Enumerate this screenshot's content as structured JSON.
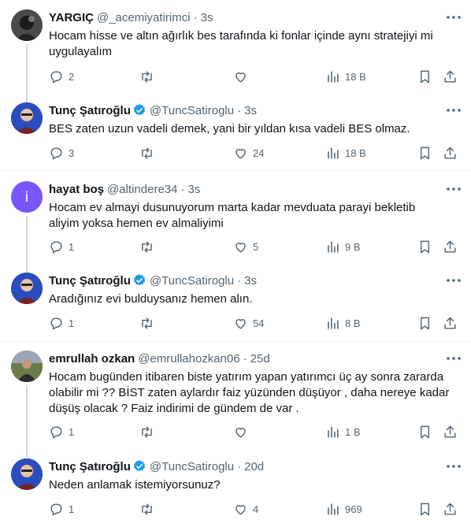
{
  "tweets": [
    {
      "name": "YARGIÇ",
      "handle": "@_acemiyatirimci",
      "time": "3s",
      "verified": false,
      "text_lines": [
        "Hocam hisse ve altın ağırlık bes tarafında ki fonlar içinde aynı stratejiyi mi",
        "uygulayalım"
      ],
      "replies": "2",
      "retweets": "",
      "likes": "",
      "views": "18 B"
    },
    {
      "name": "Tunç Şatıroğlu",
      "handle": "@TuncSatiroglu",
      "time": "3s",
      "verified": true,
      "text_lines": [
        "BES zaten uzun vadeli demek, yani bir yıldan kısa vadeli BES olmaz."
      ],
      "replies": "3",
      "retweets": "",
      "likes": "24",
      "views": "18 B"
    },
    {
      "name": "hayat boş",
      "handle": "@altindere34",
      "time": "3s",
      "verified": false,
      "avatar_letter": "i",
      "text_lines": [
        "Hocam ev almayi dusunuyorum marta kadar mevduata  parayi bekletib",
        "aliyim yoksa hemen ev almaliyimi"
      ],
      "replies": "1",
      "retweets": "",
      "likes": "5",
      "views": "9 B"
    },
    {
      "name": "Tunç Şatıroğlu",
      "handle": "@TuncSatiroglu",
      "time": "3s",
      "verified": true,
      "text_lines": [
        "Aradığınız evi bulduysanız hemen alın."
      ],
      "replies": "1",
      "retweets": "",
      "likes": "54",
      "views": "8 B"
    },
    {
      "name": "emrullah ozkan",
      "handle": "@emrullahozkan06",
      "time": "25d",
      "verified": false,
      "text_lines": [
        "Hocam bugünden itibaren biste yatırım yapan yatırımcı üç ay sonra zararda",
        "olabilir mi ?? BİST zaten aylardır faiz yüzünden düşüyor , daha nereye kadar",
        "düşüş olacak ? Faiz indirimi de gündem de var ."
      ],
      "replies": "1",
      "retweets": "",
      "likes": "",
      "views": "1 B"
    },
    {
      "name": "Tunç Şatıroğlu",
      "handle": "@TuncSatiroglu",
      "time": "20d",
      "verified": true,
      "text_lines": [
        "Neden anlamak istemiyorsunuz?"
      ],
      "replies": "1",
      "retweets": "",
      "likes": "4",
      "views": "969"
    }
  ],
  "colors": {
    "text": "#0f1419",
    "secondary": "#536471",
    "verified": "#1d9bf0",
    "thread_line": "#cfd9de",
    "divider": "#eff3f4",
    "purple_avatar": "#7856ff"
  },
  "icons": [
    "reply-icon",
    "retweet-icon",
    "like-icon",
    "views-icon",
    "bookmark-icon",
    "share-icon",
    "more-icon",
    "verified-badge-icon"
  ]
}
